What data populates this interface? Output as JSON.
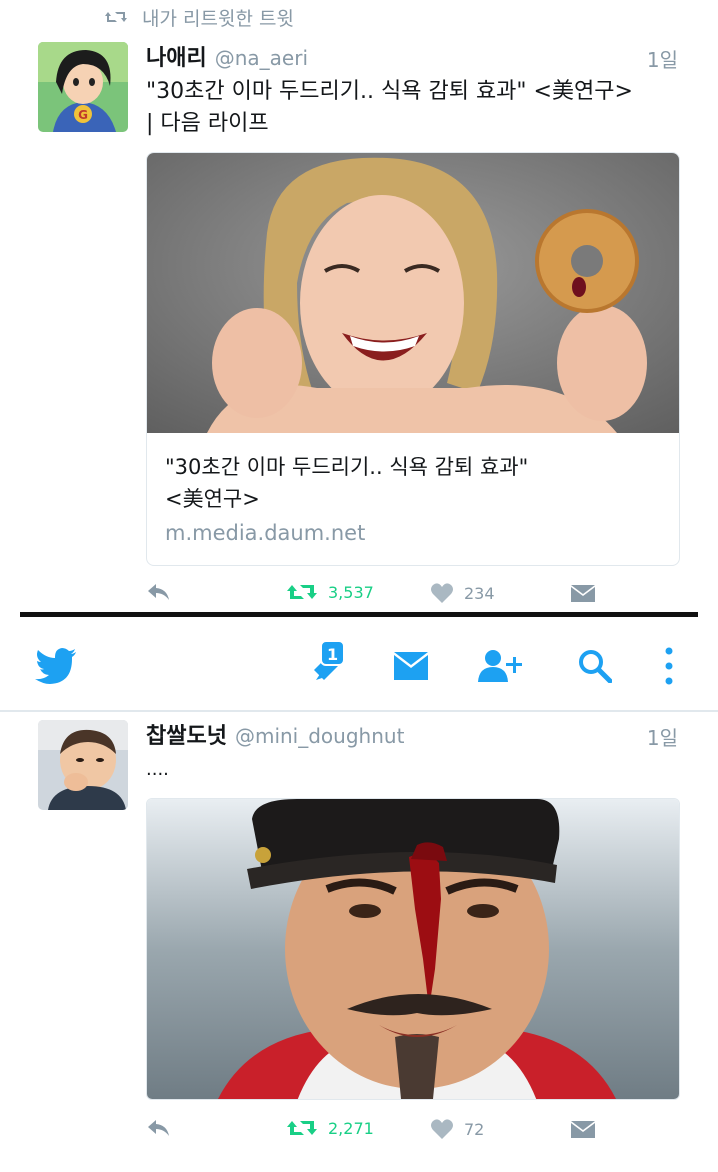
{
  "retweet_context": {
    "icon": "retweet-icon",
    "label": "내가 리트윗한 트윗"
  },
  "tweets": [
    {
      "display_name": "나애리",
      "handle": "@na_aeri",
      "time": "1일",
      "text_line1": "\"30초간 이마 두드리기.. 식욕 감퇴 효과\" <美연구>",
      "text_line2": "| 다음 라이프",
      "card": {
        "title_line1": "\"30초간 이마 두드리기.. 식욕 감퇴 효과\"",
        "title_line2": "<美연구>",
        "domain": "m.media.daum.net"
      },
      "retweets": "3,537",
      "likes": "234"
    },
    {
      "display_name": "찹쌀도넛",
      "handle": "@mini_doughnut",
      "time": "1일",
      "text": "....",
      "retweets": "2,271",
      "likes": "72"
    }
  ],
  "nav": {
    "notifications_badge": "1",
    "icons": [
      "twitter-bird-icon",
      "notifications-icon",
      "messages-icon",
      "add-user-icon",
      "search-icon",
      "more-icon"
    ]
  },
  "colors": {
    "brand": "#1da1f2",
    "retweet": "#19cf86",
    "muted": "#8899a6"
  }
}
